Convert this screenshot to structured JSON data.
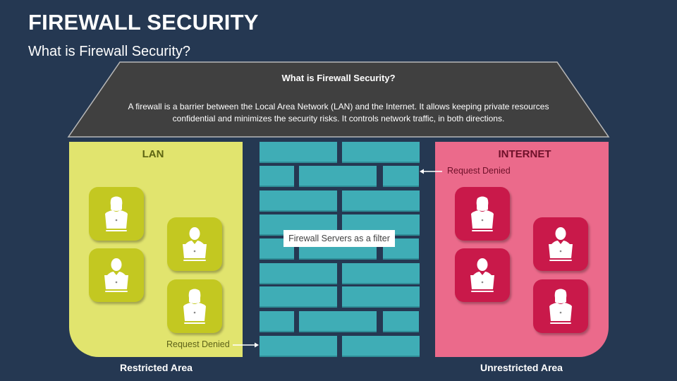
{
  "header": {
    "title": "FIREWALL SECURITY",
    "subtitle": "What is Firewall Security?"
  },
  "roof": {
    "heading": "What is Firewall Security?",
    "text": "A firewall is a barrier between the Local Area Network (LAN) and the Internet. It allows keeping private resources confidential and minimizes the security risks. It controls network traffic, in both directions."
  },
  "lan": {
    "title": "LAN",
    "area_label": "Restricted Area",
    "request_denied": "Request Denied",
    "users": [
      {
        "icon": "woman-laptop-icon"
      },
      {
        "icon": "man-laptop-icon"
      },
      {
        "icon": "man-laptop-icon"
      },
      {
        "icon": "woman-laptop-icon"
      }
    ]
  },
  "internet": {
    "title": "INTERNET",
    "area_label": "Unrestricted Area",
    "request_denied": "Request Denied",
    "users": [
      {
        "icon": "woman-laptop-icon"
      },
      {
        "icon": "man-laptop-icon"
      },
      {
        "icon": "man-laptop-icon"
      },
      {
        "icon": "woman-laptop-icon"
      }
    ]
  },
  "firewall": {
    "label": "Firewall Servers as a filter"
  },
  "colors": {
    "background": "#253852",
    "roof": "#404040",
    "lan_panel": "#e1e46e",
    "lan_tile": "#c3c821",
    "internet_panel": "#eb6a8b",
    "internet_tile": "#c9194a",
    "brick": "#3fadb6"
  }
}
